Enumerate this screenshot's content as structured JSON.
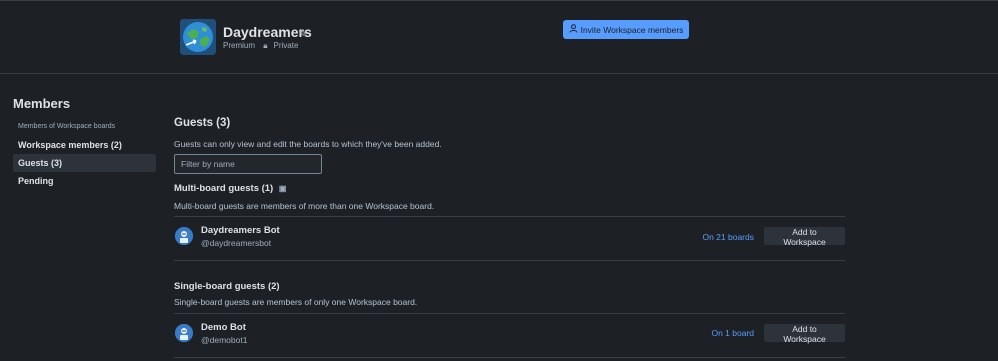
{
  "workspace": {
    "name": "Daydreamers",
    "plan": "Premium",
    "visibility": "Private",
    "invite_label": "Invite Workspace members"
  },
  "sidebar": {
    "title": "Members",
    "items": [
      {
        "label": "Members of Workspace boards"
      },
      {
        "label": "Workspace members (2)"
      },
      {
        "label": "Guests (3)"
      },
      {
        "label": "Pending"
      }
    ]
  },
  "guests": {
    "title": "Guests (3)",
    "description": "Guests can only view and edit the boards to which they've been added.",
    "filter_placeholder": "Filter by name",
    "multi": {
      "title": "Multi-board guests (1)",
      "description": "Multi-board guests are members of more than one Workspace board.",
      "members": [
        {
          "name": "Daydreamers Bot",
          "handle": "@daydreamersbot",
          "boards": "On 21 boards",
          "action": "Add to Workspace"
        }
      ]
    },
    "single": {
      "title": "Single-board guests (2)",
      "description": "Single-board guests are members of only one Workspace board.",
      "members": [
        {
          "name": "Demo Bot",
          "handle": "@demobot1",
          "boards": "On 1 board",
          "action": "Add to Workspace"
        }
      ]
    }
  },
  "colors": {
    "background": "#1d2125",
    "accent": "#579dff",
    "active_item": "#2c333a"
  }
}
